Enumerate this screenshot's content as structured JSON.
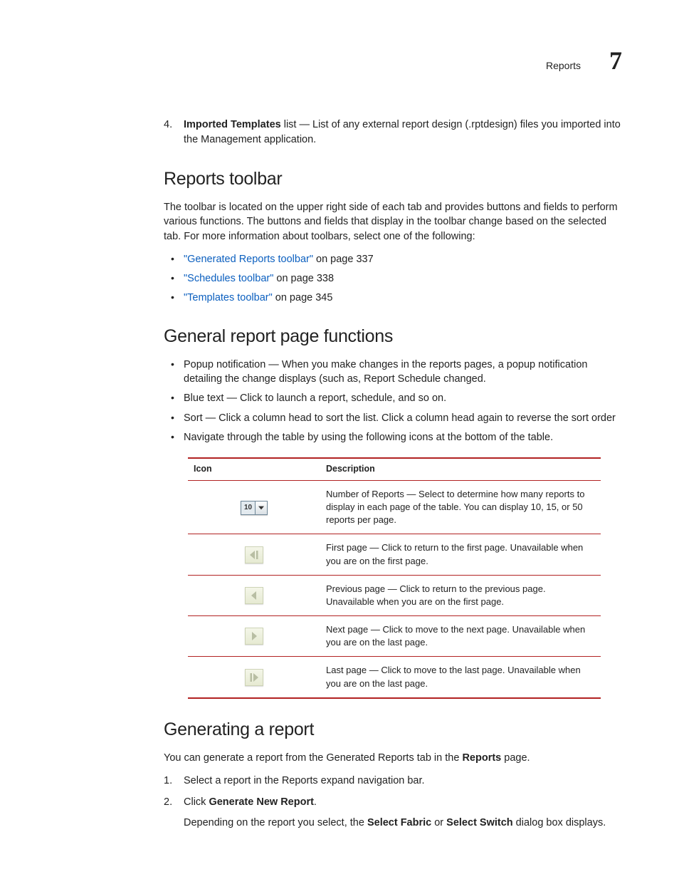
{
  "header": {
    "title": "Reports",
    "chapter": "7"
  },
  "item4": {
    "label_bold": "Imported Templates",
    "label_rest": " list — List of any external report design (.rptdesign) files you imported into the Management application."
  },
  "sec_toolbar": {
    "title": "Reports toolbar",
    "para": "The toolbar is located on the upper right side of each tab and provides buttons and fields to perform various functions. The buttons and fields that display in the toolbar change based on the selected tab. For more information about toolbars, select one of the following:",
    "links": [
      {
        "text": "\"Generated Reports toolbar\"",
        "page": " on page 337"
      },
      {
        "text": "\"Schedules toolbar\"",
        "page": " on page 338"
      },
      {
        "text": "\"Templates toolbar\"",
        "page": " on page 345"
      }
    ]
  },
  "sec_general": {
    "title": "General report page functions",
    "bullets": [
      "Popup notification — When you make changes in the reports pages, a popup notification detailing the change displays (such as, Report Schedule changed.",
      "Blue text — Click to launch a report, schedule, and so on.",
      "Sort — Click a column head to sort the list. Click a column head again to reverse the sort order",
      "Navigate through the table by using the following icons at the bottom of the table."
    ],
    "table": {
      "col_icon": "Icon",
      "col_desc": "Description",
      "rows": [
        {
          "icon": "count-select",
          "value": "10",
          "desc": "Number of Reports — Select to determine how many reports to display in each page of the table. You can display 10, 15, or 50 reports per page."
        },
        {
          "icon": "first-page",
          "desc": "First page — Click to return to the first page. Unavailable when you are on the first page."
        },
        {
          "icon": "prev-page",
          "desc": "Previous page — Click to return to the previous page. Unavailable when you are on the first page."
        },
        {
          "icon": "next-page",
          "desc": "Next page — Click to move to the next page. Unavailable when you are on the last page."
        },
        {
          "icon": "last-page",
          "desc": "Last page — Click to move to the last page. Unavailable when you are on the last page."
        }
      ]
    }
  },
  "sec_generate": {
    "title": "Generating a report",
    "intro_pre": "You can generate a report from the Generated Reports tab in the ",
    "intro_bold": "Reports",
    "intro_post": " page.",
    "step1": "Select a report in the Reports expand navigation bar.",
    "step2_pre": "Click ",
    "step2_bold": "Generate New Report",
    "step2_post": ".",
    "step2_sub_pre": "Depending on the report you select, the ",
    "step2_sub_b1": "Select Fabric",
    "step2_sub_mid": " or ",
    "step2_sub_b2": "Select Switch",
    "step2_sub_post": " dialog box displays."
  }
}
